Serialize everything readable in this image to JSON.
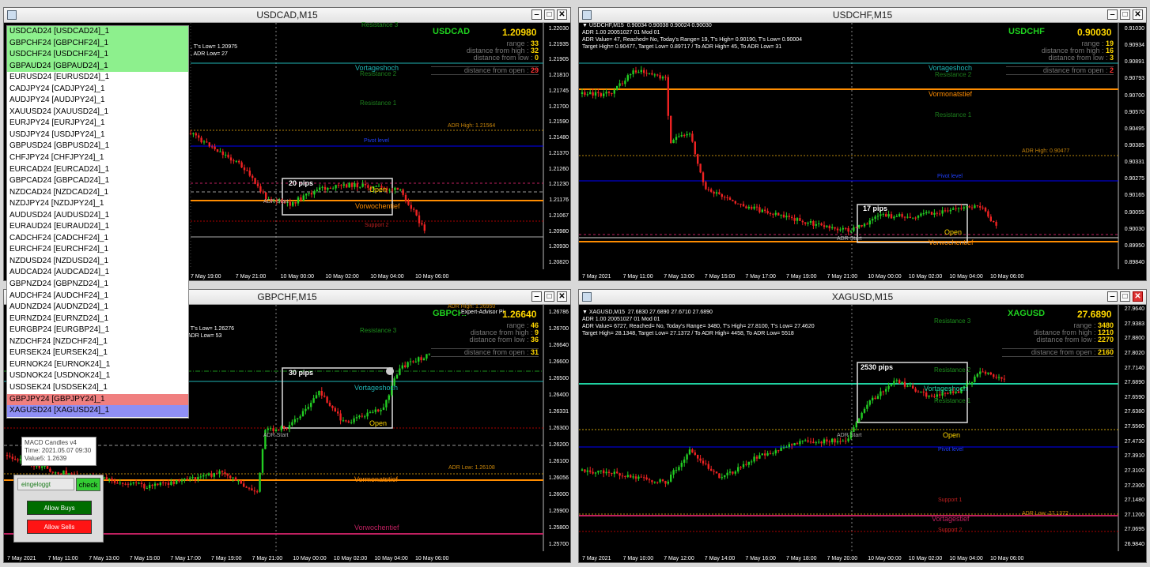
{
  "windows": {
    "usdcad": {
      "title": "USDCAD,M15",
      "info": ", T's Low= 1.20975\n, ADR Low= 27",
      "symbol": "USDCAD",
      "price": "1.20980",
      "range_label": "range :",
      "range_val": "33",
      "from_high_label": "distance from high :",
      "from_high_val": "32",
      "from_low_label": "distance from low :",
      "from_low_val": "0",
      "from_open_label": "distance from open :",
      "from_open_val": "29",
      "prices": [
        "1.22030",
        "1.21935",
        "1.21905",
        "1.21810",
        "1.21745",
        "1.21700",
        "1.21590",
        "1.21480",
        "1.21370",
        "1.21260",
        "1.21230",
        "1.21176",
        "1.21067",
        "1.20980",
        "1.20930",
        "1.20820"
      ],
      "labels": {
        "vortageshoch": "Vortageshoch",
        "resistance2": "Resistance 2",
        "resistance1": "Resistance 1",
        "adr_high": "ADR High: 1.21564",
        "pivot": "Pivot level",
        "pips": "20 pips",
        "open": "Open",
        "vorwochentief": "Vorwochentief",
        "adr_start": "ADR Start",
        "support2": "Support 2",
        "resistance3": "Resistance 3"
      },
      "times": [
        "7 May 19:00",
        "7 May 21:00",
        "10 May 00:00",
        "10 May 02:00",
        "10 May 04:00",
        "10 May 06:00"
      ]
    },
    "usdchf": {
      "title": "USDCHF,M15",
      "info": "▼ USDCHF,M15  0.90034 0.90038 0.90024 0.90030\nADR 1.00 20051027 01 Mod 01\nADR Value= 47, Reached= No, Today's Range= 19, T's High= 0.90190, T's Low= 0.90004\nTarget High= 0.90477, Target Low= 0.89717 / To ADR High= 45, To ADR Low= 31",
      "symbol": "USDCHF",
      "price": "0.90030",
      "range_label": "range :",
      "range_val": "19",
      "from_high_label": "distance from high :",
      "from_high_val": "16",
      "from_low_label": "distance from low :",
      "from_low_val": "3",
      "from_open_label": "distance from open :",
      "from_open_val": "2",
      "prices": [
        "0.91030",
        "0.90934",
        "0.90891",
        "0.90793",
        "0.90700",
        "0.90570",
        "0.90495",
        "0.90385",
        "0.90331",
        "0.90275",
        "0.90165",
        "0.90055",
        "0.90030",
        "0.89950",
        "0.89840"
      ],
      "labels": {
        "vortageshoch": "Vortageshoch",
        "resistance2": "Resistance 2",
        "vormonatstief": "Vormonatstief",
        "resistance1": "Resistance 1",
        "adr_high": "ADR High: 0.90477",
        "pivot": "Pivot level",
        "pips": "17 pips",
        "open": "Open",
        "vorwochentief": "Vorwochentief",
        "adr_start": "ADR Start"
      },
      "times": [
        "7 May 2021",
        "7 May 11:00",
        "7 May 13:00",
        "7 May 15:00",
        "7 May 17:00",
        "7 May 19:00",
        "7 May 21:00",
        "10 May 00:00",
        "10 May 02:00",
        "10 May 04:00",
        "10 May 06:00"
      ]
    },
    "gbpchf": {
      "title": "GBPCHF,M15",
      "info": ", T's Low= 1.26276\nADR Low= 53",
      "symbol": "GBPCHF",
      "price": "1.26640",
      "ea_label": "Expert-Advisor Pi",
      "range_label": "range :",
      "range_val": "46",
      "from_high_label": "distance from high :",
      "from_high_val": "9",
      "from_low_label": "distance from low :",
      "from_low_val": "36",
      "from_open_label": "distance from open :",
      "from_open_val": "31",
      "prices": [
        "1.26786",
        "1.26700",
        "1.26640",
        "1.26600",
        "1.26500",
        "1.26400",
        "1.26331",
        "1.26300",
        "1.26200",
        "1.26100",
        "1.26056",
        "1.26000",
        "1.25900",
        "1.25800",
        "1.25700"
      ],
      "labels": {
        "resistance3": "Resistance 3",
        "vortageshoch": "Vortageshoch",
        "pips": "30 pips",
        "open": "Open",
        "adr_start": "ADR Start",
        "adr_low": "ADR Low: 1.26108",
        "vormonatstief": "Vormonatstief",
        "vorwochentief": "Vorwochentief",
        "adr_high": "ADR High: 1.26950"
      },
      "times": [
        "7 May 2021",
        "7 May 11:00",
        "7 May 13:00",
        "7 May 15:00",
        "7 May 17:00",
        "7 May 19:00",
        "7 May 21:00",
        "10 May 00:00",
        "10 May 02:00",
        "10 May 04:00",
        "10 May 06:00"
      ]
    },
    "xagusd": {
      "title": "XAGUSD,M15",
      "info": "▼ XAGUSD,M15  27.6830 27.6890 27.6710 27.6890\nADR 1.00 20051027 01 Mod 01\nADR Value= 6727, Reached= No, Today's Range= 3480, T's High= 27.8100, T's Low= 27.4620\nTarget High= 28.1348, Target Low= 27.1372 / To ADR High= 4458, To ADR Low= 5518",
      "symbol": "XAGUSD",
      "price": "27.6890",
      "range_label": "range :",
      "range_val": "3480",
      "from_high_label": "distance from high :",
      "from_high_val": "1210",
      "from_low_label": "distance from low :",
      "from_low_val": "2270",
      "from_open_label": "distance from open :",
      "from_open_val": "2160",
      "prices": [
        "27.9640",
        "27.9383",
        "27.8800",
        "27.8020",
        "27.7140",
        "27.6890",
        "27.6590",
        "27.6380",
        "27.5560",
        "27.4730",
        "27.3910",
        "27.3100",
        "27.2300",
        "27.1480",
        "27.1200",
        "27.0695",
        "26.9840"
      ],
      "labels": {
        "resistance3": "Resistance 3",
        "resistance2": "Resistance 2",
        "vortageshoch": "Vortageshoch",
        "resistance1": "Resistance 1",
        "pips": "2530 pips",
        "open": "Open",
        "adr_start": "ADR Start",
        "pivot": "Pivot level",
        "support1": "Support 1",
        "adr_low": "ADR Low: 27.1372",
        "vortagestief": "Vortagestief",
        "support2": "Support 2"
      },
      "times": [
        "7 May 2021",
        "7 May 10:00",
        "7 May 12:00",
        "7 May 14:00",
        "7 May 16:00",
        "7 May 18:00",
        "7 May 20:00",
        "10 May 00:00",
        "10 May 02:00",
        "10 May 04:00",
        "10 May 06:00"
      ]
    }
  },
  "symbol_list": [
    {
      "text": "USDCAD24 [USDCAD24]_1",
      "color": "#8df08d"
    },
    {
      "text": "GBPCHF24 [GBPCHF24]_1",
      "color": "#8df08d"
    },
    {
      "text": "USDCHF24 [USDCHF24]_1",
      "color": "#8df08d"
    },
    {
      "text": "GBPAUD24 [GBPAUD24]_1",
      "color": "#8df08d"
    },
    {
      "text": "EURUSD24 [EURUSD24]_1",
      "color": "#ffffff"
    },
    {
      "text": "CADJPY24 [CADJPY24]_1",
      "color": "#ffffff"
    },
    {
      "text": "AUDJPY24 [AUDJPY24]_1",
      "color": "#ffffff"
    },
    {
      "text": "XAUUSD24 [XAUUSD24]_1",
      "color": "#ffffff"
    },
    {
      "text": "EURJPY24 [EURJPY24]_1",
      "color": "#ffffff"
    },
    {
      "text": "USDJPY24 [USDJPY24]_1",
      "color": "#ffffff"
    },
    {
      "text": "GBPUSD24 [GBPUSD24]_1",
      "color": "#ffffff"
    },
    {
      "text": "CHFJPY24 [CHFJPY24]_1",
      "color": "#ffffff"
    },
    {
      "text": "EURCAD24 [EURCAD24]_1",
      "color": "#ffffff"
    },
    {
      "text": "GBPCAD24 [GBPCAD24]_1",
      "color": "#ffffff"
    },
    {
      "text": "NZDCAD24 [NZDCAD24]_1",
      "color": "#ffffff"
    },
    {
      "text": "NZDJPY24 [NZDJPY24]_1",
      "color": "#ffffff"
    },
    {
      "text": "AUDUSD24 [AUDUSD24]_1",
      "color": "#ffffff"
    },
    {
      "text": "EURAUD24 [EURAUD24]_1",
      "color": "#ffffff"
    },
    {
      "text": "CADCHF24 [CADCHF24]_1",
      "color": "#ffffff"
    },
    {
      "text": "EURCHF24 [EURCHF24]_1",
      "color": "#ffffff"
    },
    {
      "text": "NZDUSD24 [NZDUSD24]_1",
      "color": "#ffffff"
    },
    {
      "text": "AUDCAD24 [AUDCAD24]_1",
      "color": "#ffffff"
    },
    {
      "text": "GBPNZD24 [GBPNZD24]_1",
      "color": "#ffffff"
    },
    {
      "text": "AUDCHF24 [AUDCHF24]_1",
      "color": "#ffffff"
    },
    {
      "text": "AUDNZD24 [AUDNZD24]_1",
      "color": "#ffffff"
    },
    {
      "text": "EURNZD24 [EURNZD24]_1",
      "color": "#ffffff"
    },
    {
      "text": "EURGBP24 [EURGBP24]_1",
      "color": "#ffffff"
    },
    {
      "text": "NZDCHF24 [NZDCHF24]_1",
      "color": "#ffffff"
    },
    {
      "text": "EURSEK24 [EURSEK24]_1",
      "color": "#ffffff"
    },
    {
      "text": "EURNOK24 [EURNOK24]_1",
      "color": "#ffffff"
    },
    {
      "text": "USDNOK24 [USDNOK24]_1",
      "color": "#ffffff"
    },
    {
      "text": "USDSEK24 [USDSEK24]_1",
      "color": "#ffffff"
    },
    {
      "text": "GBPJPY24 [GBPJPY24]_1",
      "color": "#f07f7f"
    },
    {
      "text": "XAGUSD24 [XAGUSD24]_1",
      "color": "#8f8ff5"
    }
  ],
  "tooltip": {
    "line1": "MACD Candles v4",
    "line2": "Time: 2021.05.07 09:30",
    "line3": "Value5: 1.2639"
  },
  "ea_panel": {
    "status": "eingeloggt",
    "check": "check",
    "allow_buys": "Allow Buys",
    "allow_sells": "Allow Sells"
  }
}
